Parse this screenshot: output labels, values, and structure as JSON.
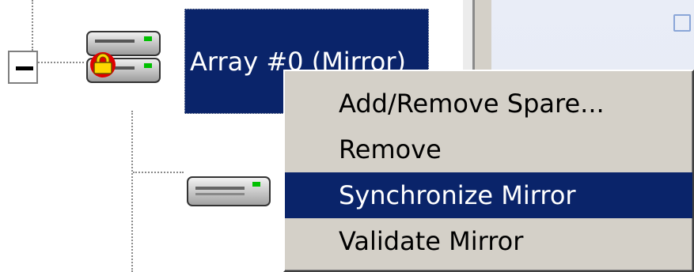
{
  "tree": {
    "array_node": {
      "label": "Array #0 (Mirror)",
      "icon": "raid-array-locked-icon",
      "expanded": true
    },
    "child_disk": {
      "icon": "hard-disk-icon"
    }
  },
  "context_menu": {
    "items": [
      {
        "label": "Add/Remove Spare...",
        "selected": false
      },
      {
        "label": "Remove",
        "selected": false
      },
      {
        "label": "Synchronize Mirror",
        "selected": true
      },
      {
        "label": "Validate Mirror",
        "selected": false
      }
    ]
  },
  "colors": {
    "selection": "#0a246a",
    "menu_background": "#d4d0c8"
  }
}
